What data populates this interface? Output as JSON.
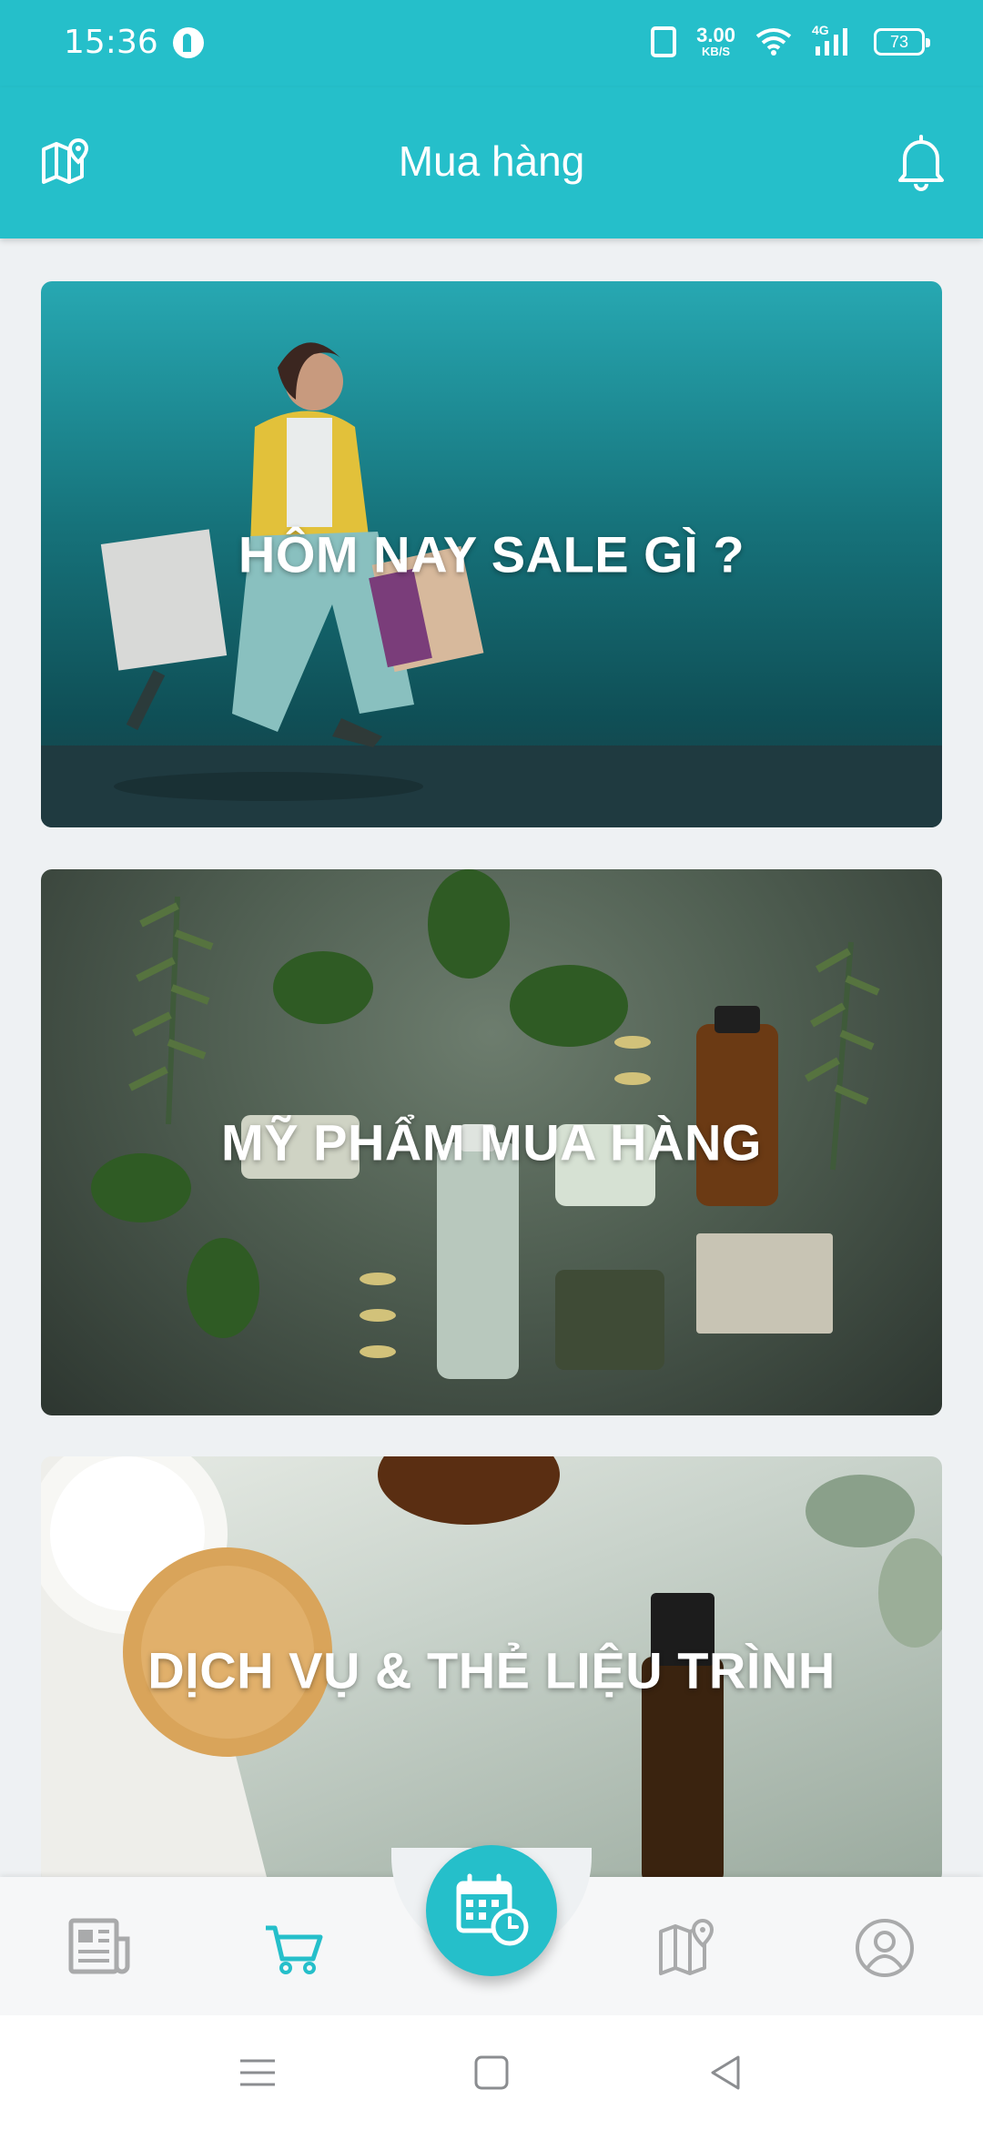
{
  "status_bar": {
    "time": "15:36",
    "network_speed_value": "3.00",
    "network_speed_unit": "KB/S",
    "network_type": "4G",
    "battery": "73"
  },
  "header": {
    "title": "Mua hàng",
    "left_icon": "map-pin-icon",
    "right_icon": "bell-icon"
  },
  "cards": [
    {
      "title": "HÔM NAY SALE GÌ ?"
    },
    {
      "title": "MỸ PHẨM MUA HÀNG"
    },
    {
      "title": "DỊCH VỤ & THẺ LIỆU TRÌNH"
    }
  ],
  "bottom_nav": {
    "items": [
      {
        "icon": "news-icon",
        "active": false
      },
      {
        "icon": "cart-icon",
        "active": true
      },
      {
        "icon": "calendar-clock-icon",
        "active": false
      },
      {
        "icon": "map-icon",
        "active": false
      },
      {
        "icon": "profile-icon",
        "active": false
      }
    ],
    "active_color": "#25bfca",
    "inactive_color": "#a9aaab"
  },
  "colors": {
    "brand": "#25bfca",
    "background": "#eef1f3"
  }
}
